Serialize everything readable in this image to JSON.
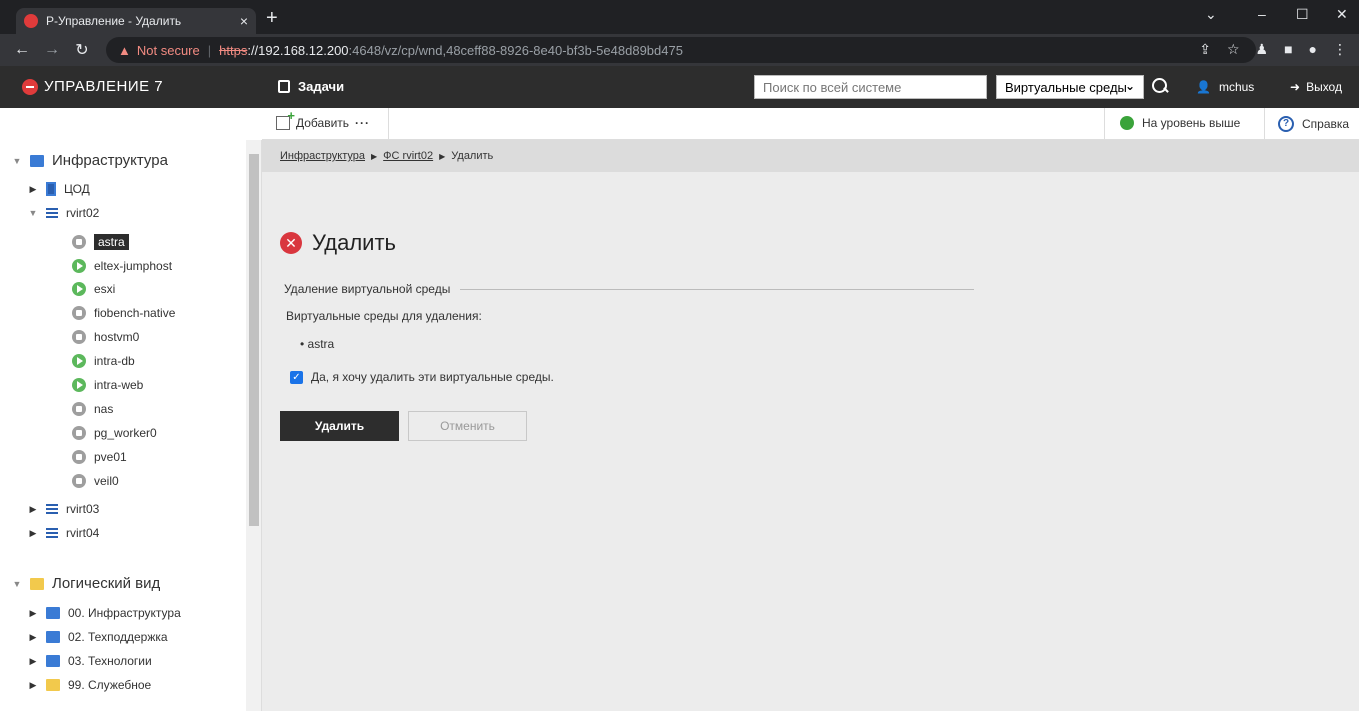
{
  "browser": {
    "tab_title": "Р-Управление - Удалить",
    "tab_close": "×",
    "new_tab": "+",
    "not_secure": "Not secure",
    "url_scheme": "https",
    "url_host": "://192.168.12.200",
    "url_path": ":4648/vz/cp/wnd,48ceff88-8926-8e40-bf3b-5e48d89bd475"
  },
  "header": {
    "logo_text": "УПРАВЛЕНИЕ 7",
    "tasks_label": "Задачи",
    "search_placeholder": "Поиск по всей системе",
    "scope_value": "Виртуальные среды",
    "user_name": "mchus",
    "logout_label": "Выход"
  },
  "sidebar": {
    "infra_label": "Инфраструктура",
    "dc_label": "ЦОД",
    "host1_label": "rvirt02",
    "vms": [
      {
        "label": "astra",
        "state": "off"
      },
      {
        "label": "eltex-jumphost",
        "state": "on"
      },
      {
        "label": "esxi",
        "state": "on"
      },
      {
        "label": "fiobench-native",
        "state": "off"
      },
      {
        "label": "hostvm0",
        "state": "off"
      },
      {
        "label": "intra-db",
        "state": "on"
      },
      {
        "label": "intra-web",
        "state": "on"
      },
      {
        "label": "nas",
        "state": "off"
      },
      {
        "label": "pg_worker0",
        "state": "off"
      },
      {
        "label": "pve01",
        "state": "off"
      },
      {
        "label": "veil0",
        "state": "off"
      }
    ],
    "host2_label": "rvirt03",
    "host3_label": "rvirt04",
    "logical_label": "Логический вид",
    "logical_items": [
      "00. Инфраструктура",
      "02. Техподдержка",
      "03. Технологии",
      "99. Служебное"
    ]
  },
  "toolbar": {
    "add_label": "Добавить",
    "more_label": "···",
    "up_label": "На уровень выше",
    "help_label": "Справка"
  },
  "breadcrumb": {
    "item1": "Инфраструктура",
    "item2": "ФС rvirt02",
    "item3": "Удалить"
  },
  "main": {
    "title": "Удалить",
    "legend": "Удаление виртуальной среды",
    "list_label": "Виртуальные среды для удаления:",
    "list_item": "astra",
    "confirm_label": "Да, я хочу удалить эти виртуальные среды.",
    "confirm_checked": true,
    "delete_button": "Удалить",
    "cancel_button": "Отменить"
  },
  "colors": {
    "header_bg": "#2d2d2d",
    "accent_red": "#d9363e",
    "vm_running": "#5cb85c",
    "vm_stopped": "#9e9e9e"
  }
}
